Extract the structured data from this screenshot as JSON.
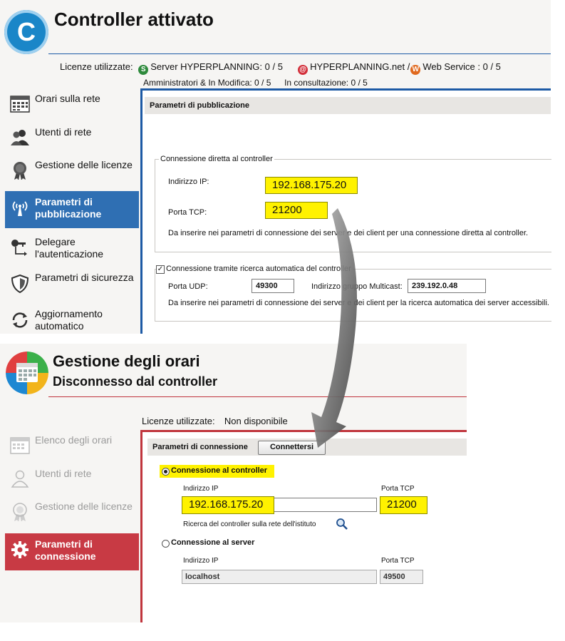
{
  "top": {
    "title": "Controller attivato",
    "logo_letter": "C",
    "licenses": {
      "label": "Licenze utilizzate:",
      "server": "Server HYPERPLANNING: 0 / 5",
      "hp_net": "HYPERPLANNING.net /",
      "web_service": "Web Service : 0 / 5",
      "admin": "Amministratori & In Modifica: 0 / 5",
      "consult": "In consultazione: 0 / 5",
      "badge_server": "S",
      "badge_net": "@",
      "badge_web": "W"
    },
    "sidebar": [
      {
        "label": "Orari sulla rete",
        "icon": "timetable-grid-icon"
      },
      {
        "label": "Utenti di rete",
        "icon": "users-icon"
      },
      {
        "label": "Gestione delle licenze",
        "icon": "license-ribbon-icon"
      },
      {
        "label": "Parametri di pubblicazione",
        "icon": "antenna-icon"
      },
      {
        "label": "Delegare l'autenticazione",
        "icon": "key-arrow-icon"
      },
      {
        "label": "Parametri di sicurezza",
        "icon": "shield-icon"
      },
      {
        "label": "Aggiornamento automatico",
        "icon": "refresh-icon"
      }
    ],
    "section_header": "Parametri di pubblicazione",
    "direct": {
      "legend": "Connessione diretta al controller",
      "ip_label": "Indirizzo IP:",
      "ip_value": "192.168.175.20",
      "tcp_label": "Porta TCP:",
      "tcp_value": "21200",
      "note": "Da inserire nei parametri di connessione dei server e dei client per una connessione diretta al controller."
    },
    "auto": {
      "legend": "Connessione tramite ricerca automatica del controller",
      "checked": true,
      "udp_label": "Porta UDP:",
      "udp_value": "49300",
      "multicast_label": "Indirizzo gruppo Multicast:",
      "multicast_value": "239.192.0.48",
      "note": "Da inserire nei parametri di connessione dei server e dei client per la ricerca automatica dei server accessibili."
    }
  },
  "bottom": {
    "title": "Gestione degli orari",
    "subtitle": "Disconnesso dal controller",
    "licenses_label": "Licenze utilizzate:",
    "licenses_value": "Non disponibile",
    "sidebar": [
      {
        "label": "Elenco degli orari",
        "icon": "timetable-grid-icon"
      },
      {
        "label": "Utenti di rete",
        "icon": "user-icon"
      },
      {
        "label": "Gestione delle licenze",
        "icon": "license-ribbon-icon"
      },
      {
        "label": "Parametri di connessione",
        "icon": "gear-icon"
      }
    ],
    "section_header": "Parametri di connessione",
    "connect_button": "Connettersi",
    "controller": {
      "label": "Connessione al controller",
      "selected": true,
      "ip_label": "Indirizzo IP",
      "ip_value": "192.168.175.20",
      "tcp_label": "Porta TCP",
      "tcp_value": "21200",
      "search_label": "Ricerca del controller sulla rete dell'istituto"
    },
    "server": {
      "label": "Connessione al server",
      "selected": false,
      "ip_label": "Indirizzo IP",
      "ip_value": "localhost",
      "tcp_label": "Porta TCP",
      "tcp_value": "49500"
    }
  },
  "colors": {
    "top_accent": "#2f6fb3",
    "bottom_accent": "#c83a44",
    "highlight": "#fff200"
  }
}
